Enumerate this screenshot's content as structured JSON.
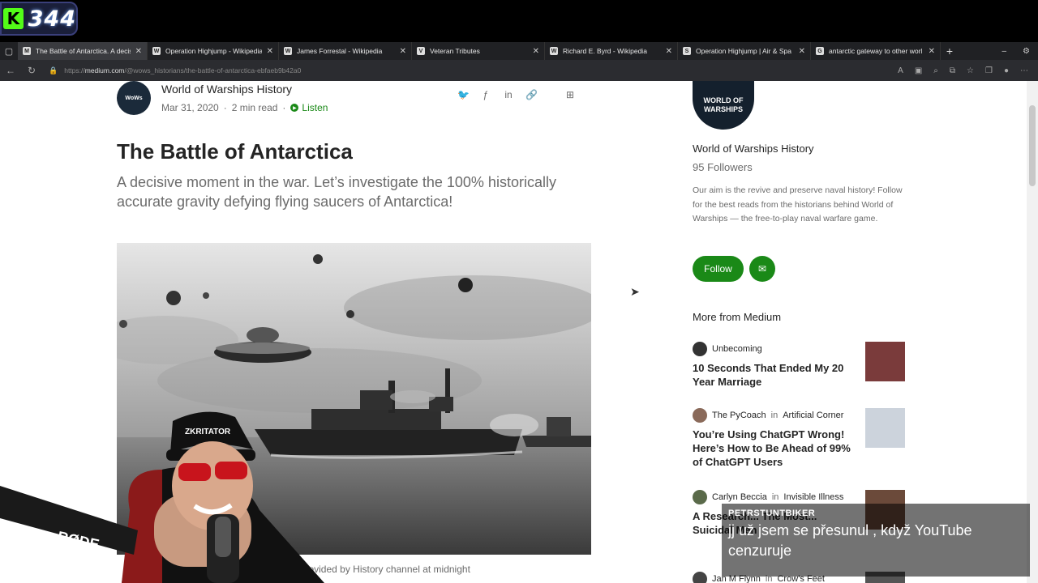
{
  "stream": {
    "platform_logo": "K",
    "viewer_count": "344",
    "chat": {
      "username": "PETRSTUNTBIKER",
      "message": "jj už jsem se přesunul , když YouTube cenzuruje"
    },
    "mic_brand": "RØDE",
    "cap_text": "ZKRITATOR"
  },
  "browser": {
    "tabs": [
      {
        "label": "The Battle of Antarctica. A decis",
        "favicon": "M",
        "active": true
      },
      {
        "label": "Operation Highjump - Wikipedia",
        "favicon": "W",
        "active": false
      },
      {
        "label": "James Forrestal - Wikipedia",
        "favicon": "W",
        "active": false
      },
      {
        "label": "Veteran Tributes",
        "favicon": "V",
        "active": false
      },
      {
        "label": "Richard E. Byrd - Wikipedia",
        "favicon": "W",
        "active": false
      },
      {
        "label": "Operation Highjump | Air & Spa",
        "favicon": "S",
        "active": false
      },
      {
        "label": "antarctic gateway to other worl",
        "favicon": "G",
        "active": false
      }
    ],
    "url_prefix": "https://",
    "url_domain": "medium.com",
    "url_path": "/@wows_historians/the-battle-of-antarctica-ebfaeb9b42a0"
  },
  "article": {
    "author": "World of Warships History",
    "date": "Mar 31, 2020",
    "read_time": "2 min read",
    "listen_label": "Listen",
    "title": "The Battle of Antarctica",
    "subtitle": "A decisive moment in the war. Let’s investigate the 100% historically accurate gravity defying flying saucers of Antarctica!",
    "caption": "saucer. Photo provided by History channel at midnight"
  },
  "sidebar": {
    "avatar_text": "WORLD OF WARSHIPS",
    "name": "World of Warships History",
    "followers": "95 Followers",
    "bio": "Our aim is the revive and preserve naval history! Follow for the best reads from the historians behind World of Warships — the free-to-play naval warfare game.",
    "follow_label": "Follow",
    "more_heading": "More from Medium",
    "recommendations": [
      {
        "author": "Unbecoming",
        "publication": "",
        "in": "",
        "title": "10 Seconds That Ended My 20 Year Marriage"
      },
      {
        "author": "The PyCoach",
        "publication": "Artificial Corner",
        "in": "in",
        "title": "You’re Using ChatGPT Wrong! Here’s How to Be Ahead of 99% of ChatGPT Users"
      },
      {
        "author": "Carlyn Beccia",
        "publication": "Invisible Illness",
        "in": "in",
        "title": "A Research... The Most... Suicidal Men"
      },
      {
        "author": "Jan M Flynn",
        "publication": "Crow’s Feet",
        "in": "in",
        "title": ""
      }
    ]
  },
  "colors": {
    "medium_green": "#1a8917",
    "kick_green": "#53fc18"
  }
}
